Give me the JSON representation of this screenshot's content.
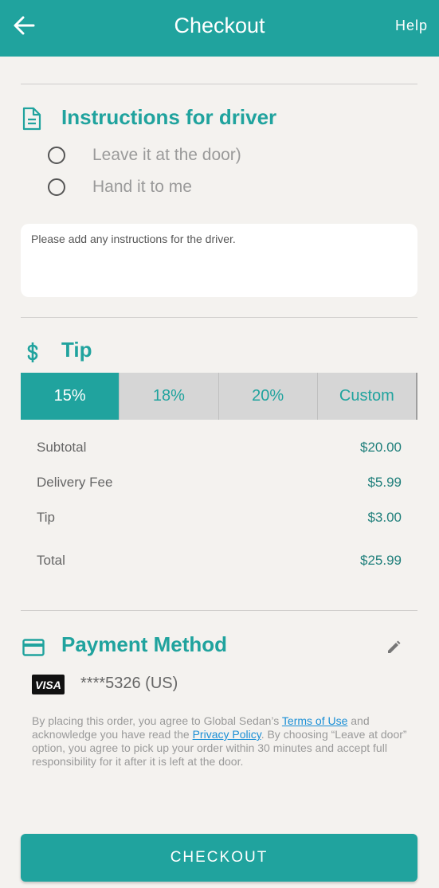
{
  "header": {
    "title": "Checkout",
    "help_label": "Help"
  },
  "instructions": {
    "title": "Instructions for driver",
    "options": [
      "Leave it at the door)",
      "Hand it to me"
    ],
    "placeholder": "Please add any instructions for the driver."
  },
  "tip": {
    "title": "Tip",
    "options": [
      "15%",
      "18%",
      "20%",
      "Custom"
    ],
    "selected": "15%"
  },
  "summary": {
    "subtotal_label": "Subtotal",
    "subtotal_value": "$20.00",
    "delivery_label": "Delivery Fee",
    "delivery_value": "$5.99",
    "tip_label": "Tip",
    "tip_value": "$3.00",
    "total_label": "Total",
    "total_value": "$25.99"
  },
  "payment": {
    "title": "Payment Method",
    "card_brand": "VISA",
    "card_number": "****5326 (US)"
  },
  "legal": {
    "text_1": "By placing this order, you agree to Global Sedan’s ",
    "terms_link": "Terms of Use",
    "text_2": " and acknowledge you have read the ",
    "privacy_link": "Privacy Policy",
    "text_3": ". By choosing “Leave at door” option, you agree to pick up your order within 30 minutes and accept full responsibility for it after it is left at the door."
  },
  "checkout_button": "CHECKOUT",
  "colors": {
    "accent": "#20a39e",
    "link": "#1a8fd6"
  }
}
